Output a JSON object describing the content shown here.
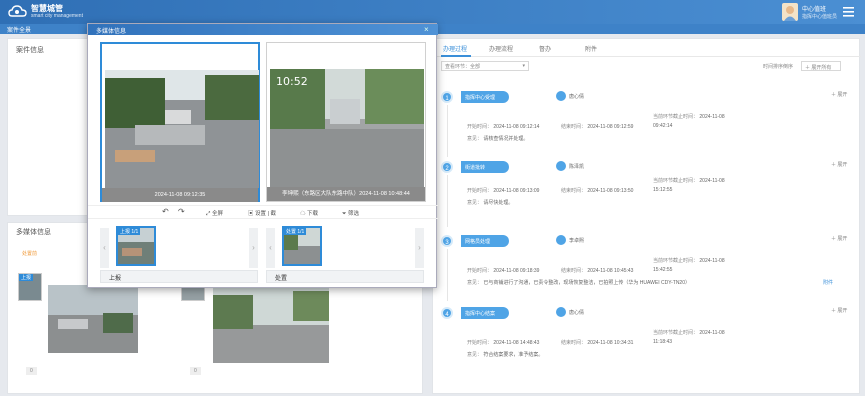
{
  "header": {
    "brand": "智慧城管",
    "brand_sub": "smart city management",
    "user_name": "中心值班",
    "user_role": "指挥中心值班员"
  },
  "breadcrumb": "案件全景",
  "left": {
    "panel1_title": "案件信息",
    "panel2_title": "多媒体信息",
    "panel2_note": "处置前",
    "thumb_tag": "上报",
    "pager": "0"
  },
  "right": {
    "tabs": [
      {
        "label": "办理过程",
        "active": true
      },
      {
        "label": "办理流程"
      },
      {
        "label": "督办"
      },
      {
        "label": "附件"
      }
    ],
    "filter": "查看环节：全部",
    "sort_label": "时间排序倒序",
    "expand_all": "展开所有",
    "labels": {
      "deadline": "当前环节截止时间：",
      "start": "开始时间：",
      "end": "结束时间：",
      "opinion": "意见：",
      "unfold": "展开"
    },
    "steps": [
      {
        "num": "1",
        "name": "指挥中心受理",
        "person": "唐心倩",
        "deadline": "2024-11-08",
        "start": "2024-11-08 09:12:14",
        "end": "2024-11-08 09:12:59",
        "deadline_time": "09:42:14",
        "opinion": "请核查情况并处理。"
      },
      {
        "num": "2",
        "name": "街道批转",
        "person": "陈泽凯",
        "deadline": "2024-11-08",
        "start": "2024-11-08 09:13:09",
        "end": "2024-11-08 09:13:50",
        "deadline_time": "15:12:55",
        "opinion": "请尽快处理。"
      },
      {
        "num": "3",
        "name": "网格员处理",
        "person": "李卓熙",
        "deadline": "2024-11-08",
        "start": "2024-11-08 09:18:39",
        "end": "2024-11-08 10:45:43",
        "deadline_time": "15:42:55",
        "opinion": "已与商铺进行了沟通，已责令整改，现场恢复整洁，已拍照上传（华为 HUAWEI CDY-TN20）",
        "op_link": "附件"
      },
      {
        "num": "4",
        "name": "指挥中心结案",
        "person": "唐心倩",
        "deadline": "2024-11-08",
        "start": "2024-11-08 14:48:43",
        "end": "2024-11-08 10:34:31",
        "deadline_time": "11:18:43",
        "opinion": "符合结案要求，准予结案。"
      }
    ]
  },
  "modal": {
    "title": "多媒体信息",
    "photo1_caption": "2024-11-08 09:12:35",
    "photo2_caption": "李坤熙（东路区大队东路中队）2024-11-08 10:48:44",
    "photo2_overlay": "10:52",
    "toolbar": {
      "rotate_left": "↶",
      "rotate_right": "↷",
      "fullscreen": "全屏",
      "compare": "设置 | 截",
      "download": "下载",
      "filter": "筛选"
    },
    "strips": [
      {
        "tag": "上报 1/1",
        "label": "上报"
      },
      {
        "tag": "处置 1/1",
        "label": "处置"
      }
    ]
  },
  "colors": {
    "accent": "#3a8fd9",
    "header": "#2f6fb5"
  }
}
